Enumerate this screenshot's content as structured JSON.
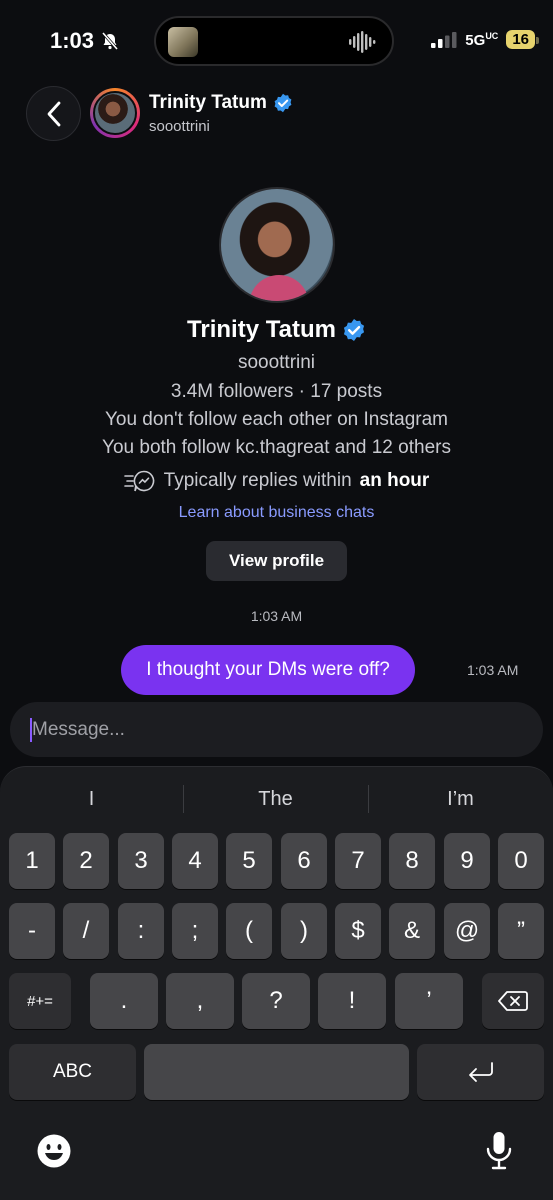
{
  "status": {
    "time": "1:03",
    "network": "5G",
    "network_sub": "UC",
    "battery": "16"
  },
  "header": {
    "name": "Trinity Tatum",
    "username": "sooottrini"
  },
  "profile": {
    "name": "Trinity Tatum",
    "username": "sooottrini",
    "stats": "3.4M followers · 17 posts",
    "follow_status": "You don't follow each other on Instagram",
    "mutuals": "You both follow kc.thagreat and 12 others",
    "reply_prefix": "Typically replies within",
    "reply_time": "an hour",
    "learn_link": "Learn about business chats",
    "view_profile": "View profile"
  },
  "messages": {
    "thread_time": "1:03 AM",
    "items": [
      {
        "text": "I thought your DMs were off?",
        "time": "1:03 AM"
      }
    ]
  },
  "composer": {
    "placeholder": "Message..."
  },
  "keyboard": {
    "suggestions": [
      "I",
      "The",
      "I’m"
    ],
    "row1": [
      "1",
      "2",
      "3",
      "4",
      "5",
      "6",
      "7",
      "8",
      "9",
      "0"
    ],
    "row2": [
      "-",
      "/",
      ":",
      ";",
      "(",
      ")",
      "$",
      "&",
      "@",
      "”"
    ],
    "row3": [
      "#+=",
      ".",
      ",",
      "?",
      "!",
      "’"
    ],
    "abc": "ABC"
  },
  "colors": {
    "accent_bubble": "#7a33f0",
    "link": "#8a9bff",
    "verified": "#3897f0"
  }
}
